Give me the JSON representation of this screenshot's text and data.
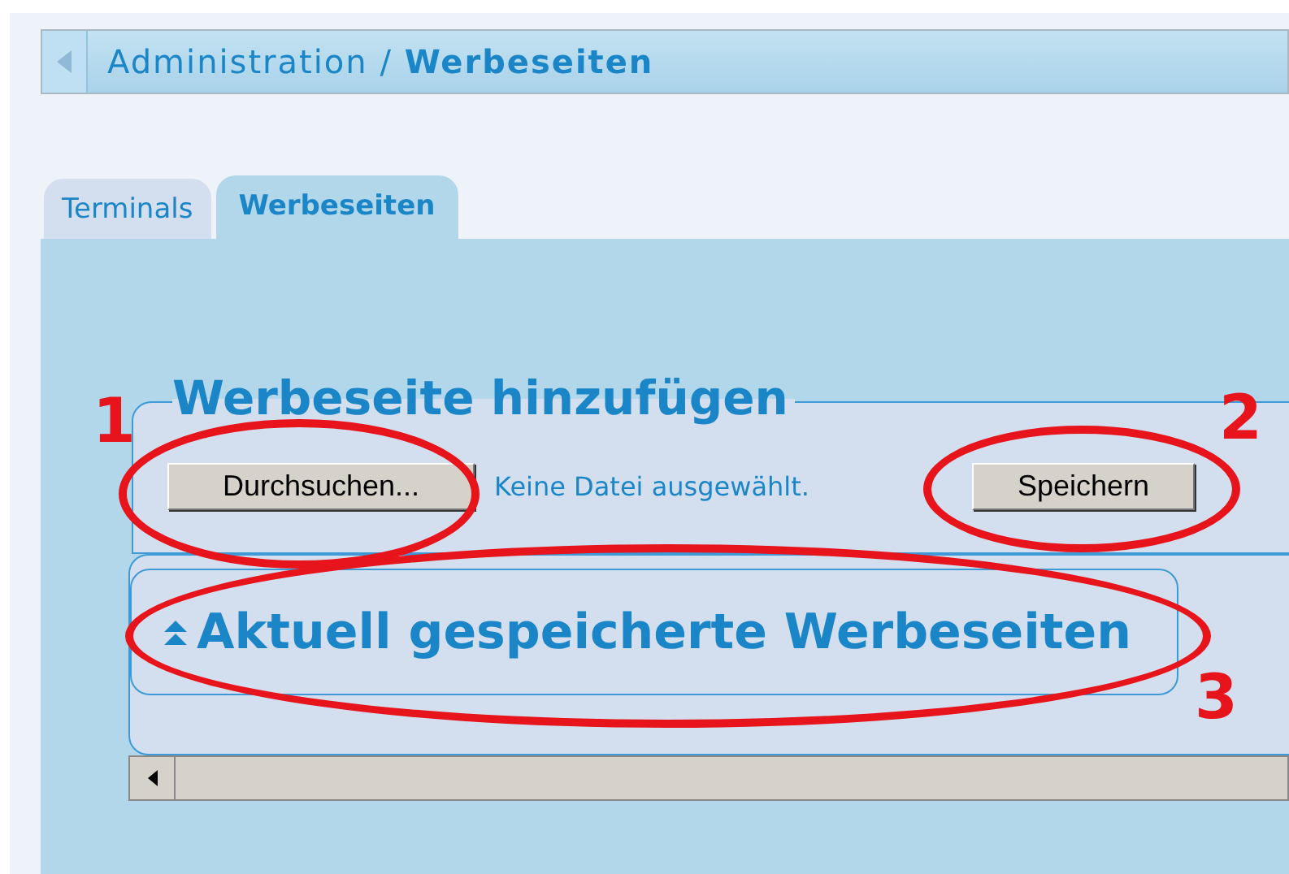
{
  "header": {
    "breadcrumb": "Administration /",
    "current": "Werbeseiten"
  },
  "tabs": [
    {
      "label": "Terminals",
      "selected": false
    },
    {
      "label": "Werbeseiten",
      "selected": true
    }
  ],
  "add_section": {
    "title": "Werbeseite hinzufügen",
    "browse_button": "Durchsuchen...",
    "file_status": "Keine Datei ausgewählt.",
    "save_button": "Speichern"
  },
  "saved_section": {
    "title": "Aktuell gespeicherte Werbeseiten",
    "expanded": true
  },
  "annotations": [
    {
      "label": "1",
      "kind": "browse"
    },
    {
      "label": "2",
      "kind": "save"
    },
    {
      "label": "3",
      "kind": "saved"
    }
  ]
}
